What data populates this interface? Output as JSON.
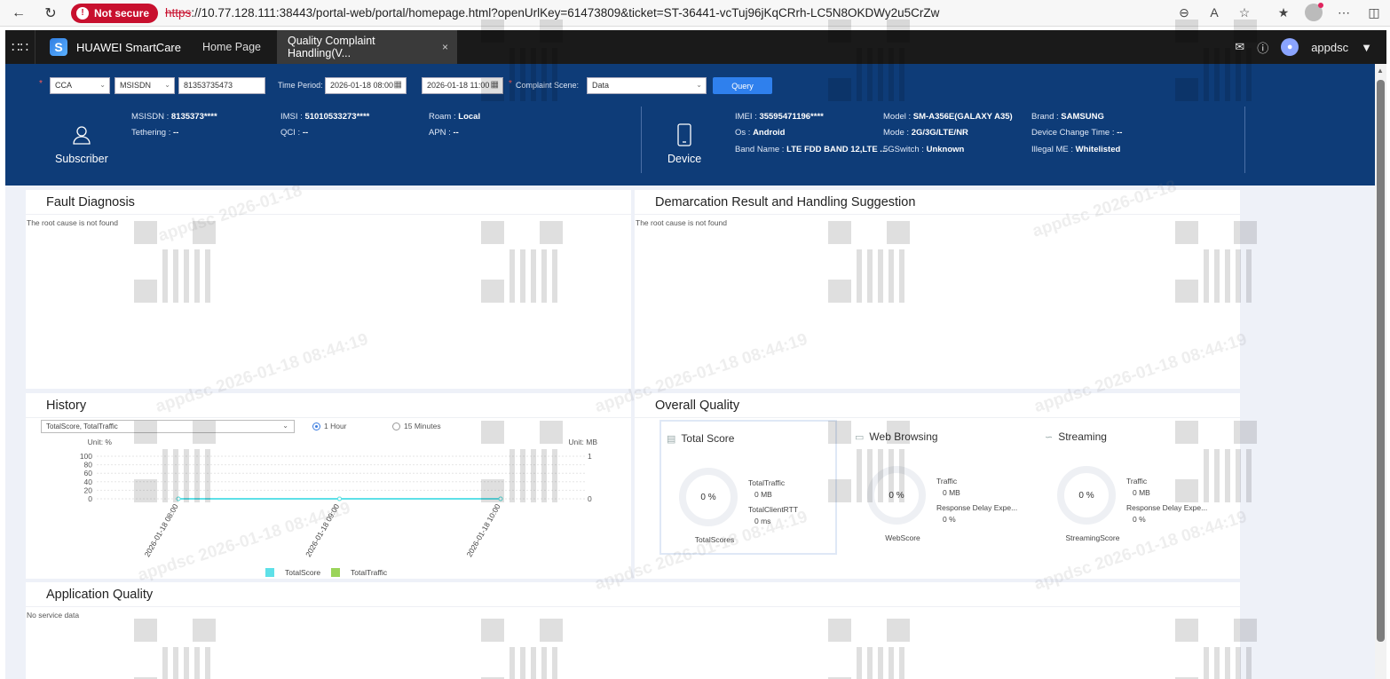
{
  "browser": {
    "secure_label": "Not secure",
    "url_proto": "https",
    "url_rest": "://10.77.128.111:38443/portal-web/portal/homepage.html?openUrlKey=61473809&ticket=ST-36441-vcTuj96jKqCRrh-LC5N8OKDWy2u5CrZw"
  },
  "header": {
    "brand": "HUAWEI SmartCare",
    "tabs": [
      {
        "label": "Home Page"
      },
      {
        "label": "Quality Complaint Handling(V..."
      }
    ],
    "tab_close": "×",
    "user": "appdsc"
  },
  "query": {
    "type": "CCA",
    "id_type": "MSISDN",
    "id_value": "81353735473",
    "time_label": "Time Period:",
    "start": "2026-01-18 08:00",
    "end": "2026-01-18 11:00",
    "scene_label": "Complaint Scene:",
    "scene": "Data",
    "query_btn": "Query"
  },
  "subscriber": {
    "label": "Subscriber",
    "fields": [
      {
        "k": "MSISDN",
        "v": "8135373****"
      },
      {
        "k": "IMSI",
        "v": "51010533273****"
      },
      {
        "k": "Roam",
        "v": "Local"
      },
      {
        "k": "Tethering",
        "v": "--"
      },
      {
        "k": "QCI",
        "v": "--"
      },
      {
        "k": "APN",
        "v": "--"
      }
    ]
  },
  "device": {
    "label": "Device",
    "fields": [
      {
        "k": "IMEI",
        "v": "35595471196****"
      },
      {
        "k": "Model",
        "v": "SM-A356E(GALAXY A35)"
      },
      {
        "k": "Brand",
        "v": "SAMSUNG"
      },
      {
        "k": "Os",
        "v": "Android"
      },
      {
        "k": "Mode",
        "v": "2G/3G/LTE/NR"
      },
      {
        "k": "Device Change Time",
        "v": "--"
      },
      {
        "k": "Band Name",
        "v": "LTE FDD BAND 12,LTE ..."
      },
      {
        "k": "5GSwitch",
        "v": "Unknown"
      },
      {
        "k": "Illegal ME",
        "v": "Whitelisted"
      }
    ]
  },
  "fault": {
    "title": "Fault Diagnosis",
    "msg": "The root cause is not found"
  },
  "demarcation": {
    "title": "Demarcation Result and Handling Suggestion",
    "msg": "The root cause is not found"
  },
  "history": {
    "title": "History",
    "select": "TotalScore, TotalTraffic",
    "radio_1h": "1 Hour",
    "radio_15m": "15 Minutes"
  },
  "chart_data": {
    "type": "line",
    "x": [
      "2026-01-18 08:00",
      "2026-01-18 09:00",
      "2026-01-18 10:00"
    ],
    "series": [
      {
        "name": "TotalScore",
        "values": [
          0,
          0,
          0
        ],
        "color": "#5ee0e8"
      },
      {
        "name": "TotalTraffic",
        "values": [
          0,
          0,
          0
        ],
        "color": "#9ad45a"
      }
    ],
    "ylabel": "Unit: %",
    "y2label": "Unit: MB",
    "y_ticks": [
      "100",
      "80",
      "60",
      "40",
      "20",
      "0"
    ],
    "y2_ticks": [
      "1",
      "0"
    ],
    "ylim": [
      0,
      100
    ],
    "y2lim": [
      0,
      1
    ],
    "grid": true,
    "legend": "bottom"
  },
  "overall": {
    "title": "Overall Quality",
    "cards": [
      {
        "title": "Total Score",
        "ring": "0 %",
        "m1": "TotalTraffic",
        "v1": "0 MB",
        "m2": "TotalClientRTT",
        "v2": "0 ms",
        "score": "TotalScores"
      },
      {
        "title": "Web Browsing",
        "ring": "0 %",
        "m1": "Traffic",
        "v1": "0 MB",
        "m2": "Response Delay Expe...",
        "v2": "0 %",
        "score": "WebScore"
      },
      {
        "title": "Streaming",
        "ring": "0 %",
        "m1": "Traffic",
        "v1": "0 MB",
        "m2": "Response Delay Expe...",
        "v2": "0 %",
        "score": "StreamingScore"
      }
    ]
  },
  "app_quality": {
    "title": "Application Quality",
    "msg": "No service data"
  },
  "watermark": "appdsc 2026-01-18 08:44:19",
  "watermark_short": "appdsc 2026-01-18"
}
